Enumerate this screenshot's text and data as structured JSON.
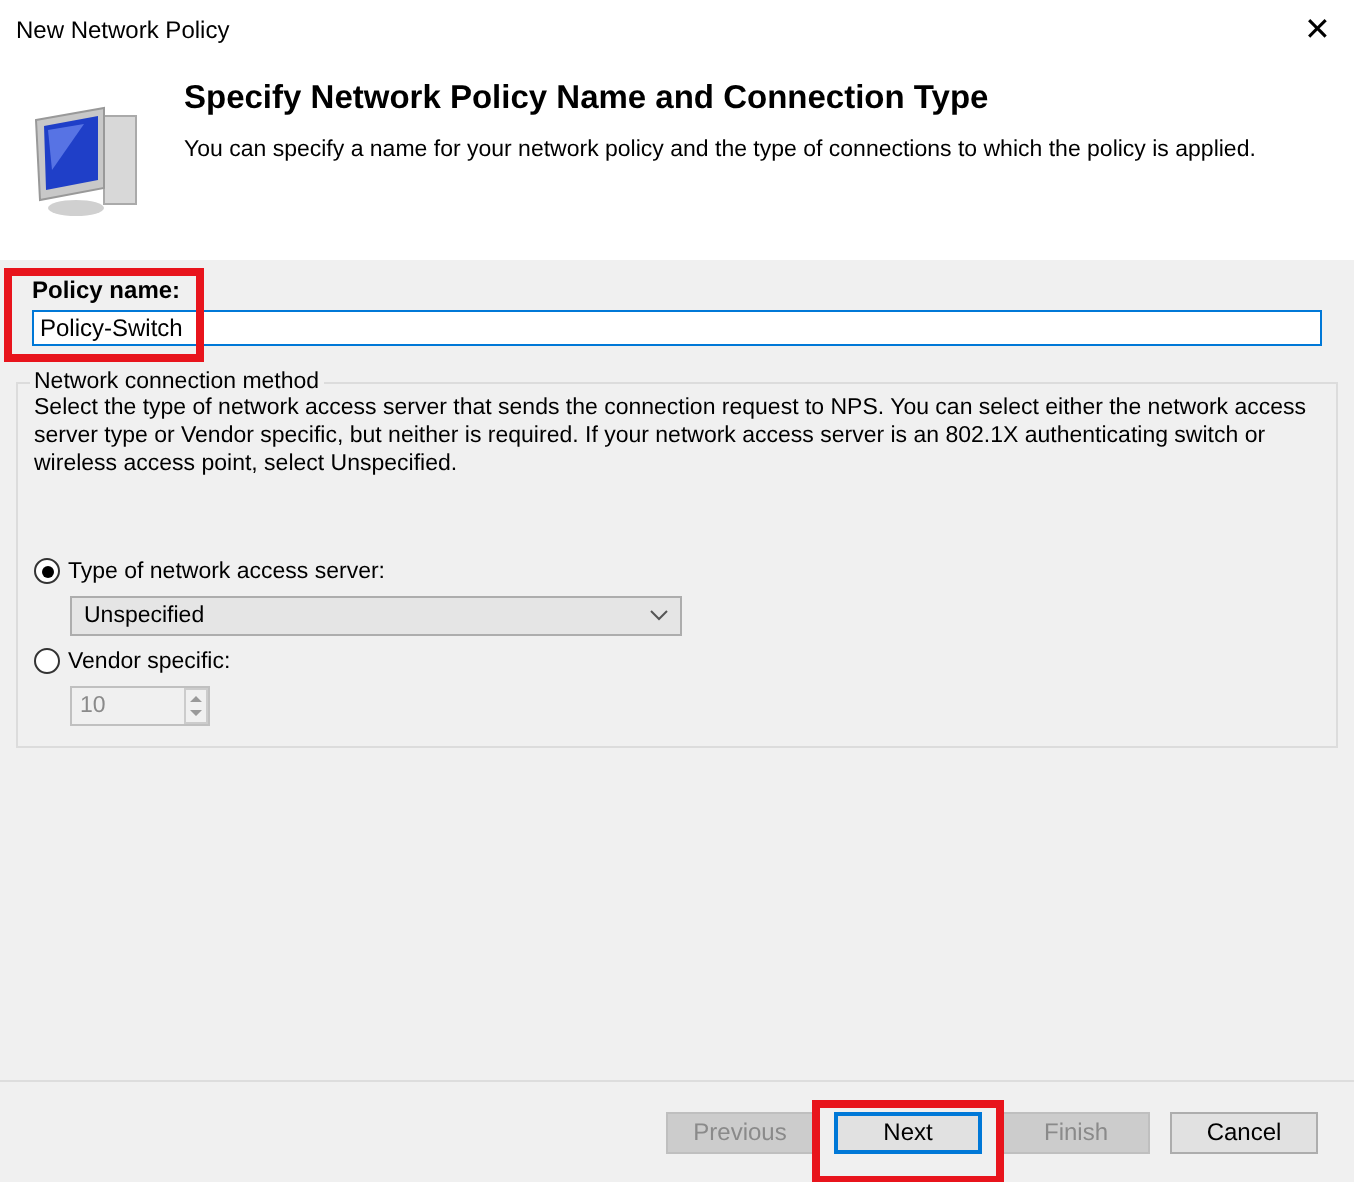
{
  "window": {
    "title": "New Network Policy",
    "close": "✕"
  },
  "header": {
    "title": "Specify Network Policy Name and Connection Type",
    "subtitle": "You can specify a name for your network policy and the type of connections to which the policy is applied."
  },
  "policy_name": {
    "label": "Policy name:",
    "value": "Policy-Switch",
    "highlighted": true
  },
  "group": {
    "legend": "Network connection method",
    "description": "Select the type of network access server that sends the connection request to NPS. You can select either the network access server type or Vendor specific, but neither is required.  If your network access server is an 802.1X authenticating switch or wireless access point, select Unspecified.",
    "options": [
      {
        "label": "Type of network access server:",
        "selected": true,
        "kind": "dropdown",
        "value": "Unspecified"
      },
      {
        "label": "Vendor specific:",
        "selected": false,
        "kind": "spinner",
        "value": "10"
      }
    ]
  },
  "buttons": [
    {
      "label": "Previous",
      "disabled": true,
      "focused": false,
      "highlighted": false
    },
    {
      "label": "Next",
      "disabled": false,
      "focused": true,
      "highlighted": true
    },
    {
      "label": "Finish",
      "disabled": true,
      "focused": false,
      "highlighted": false
    },
    {
      "label": "Cancel",
      "disabled": false,
      "focused": false,
      "highlighted": false
    }
  ]
}
